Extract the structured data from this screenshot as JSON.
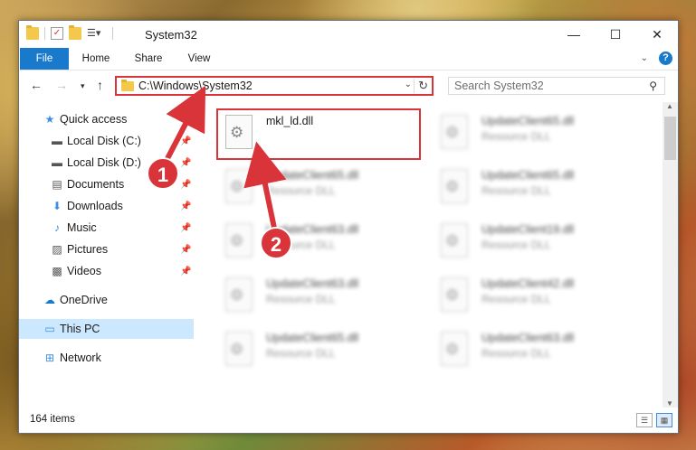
{
  "window": {
    "title": "System32"
  },
  "controls": {
    "minimize": "—",
    "maximize": "☐",
    "close": "✕"
  },
  "ribbon": {
    "tabs": [
      "File",
      "Home",
      "Share",
      "View"
    ]
  },
  "address": {
    "path": "C:\\Windows\\System32"
  },
  "search": {
    "placeholder": "Search System32"
  },
  "sidebar": {
    "items": [
      {
        "label": "Quick access",
        "icon": "star-icon",
        "pinned": false
      },
      {
        "label": "Local Disk (C:)",
        "icon": "drive-icon",
        "pinned": true
      },
      {
        "label": "Local Disk (D:)",
        "icon": "drive-icon",
        "pinned": true
      },
      {
        "label": "Documents",
        "icon": "document-icon",
        "pinned": true
      },
      {
        "label": "Downloads",
        "icon": "download-icon",
        "pinned": true
      },
      {
        "label": "Music",
        "icon": "music-icon",
        "pinned": true
      },
      {
        "label": "Pictures",
        "icon": "pictures-icon",
        "pinned": true
      },
      {
        "label": "Videos",
        "icon": "video-icon",
        "pinned": true
      },
      {
        "label": "OneDrive",
        "icon": "cloud-icon",
        "pinned": false
      },
      {
        "label": "This PC",
        "icon": "computer-icon",
        "pinned": false,
        "selected": true
      },
      {
        "label": "Network",
        "icon": "network-icon",
        "pinned": false
      }
    ]
  },
  "files": {
    "highlighted": {
      "name": "mkl_ld.dll"
    },
    "left": [
      {
        "name": "UpdateClient65.dll",
        "type": "Resource DLL"
      },
      {
        "name": "UpdateClient63.dll",
        "type": "Resource DLL"
      },
      {
        "name": "UpdateClient63.dll",
        "type": "Resource DLL"
      },
      {
        "name": "UpdateClient65.dll",
        "type": "Resource DLL"
      }
    ],
    "right": [
      {
        "name": "UpdateClient65.dll",
        "type": "Resource DLL"
      },
      {
        "name": "UpdateClient65.dll",
        "type": "Resource DLL"
      },
      {
        "name": "UpdateClient19.dll",
        "type": "Resource DLL"
      },
      {
        "name": "UpdateClient42.dll",
        "type": "Resource DLL"
      },
      {
        "name": "UpdateClient63.dll",
        "type": "Resource DLL"
      }
    ]
  },
  "status": {
    "item_count": "164 items"
  },
  "annotations": {
    "step1": "1",
    "step2": "2"
  },
  "colors": {
    "accent": "#1979ca",
    "highlight": "#d9343a",
    "selection": "#cce8ff"
  }
}
